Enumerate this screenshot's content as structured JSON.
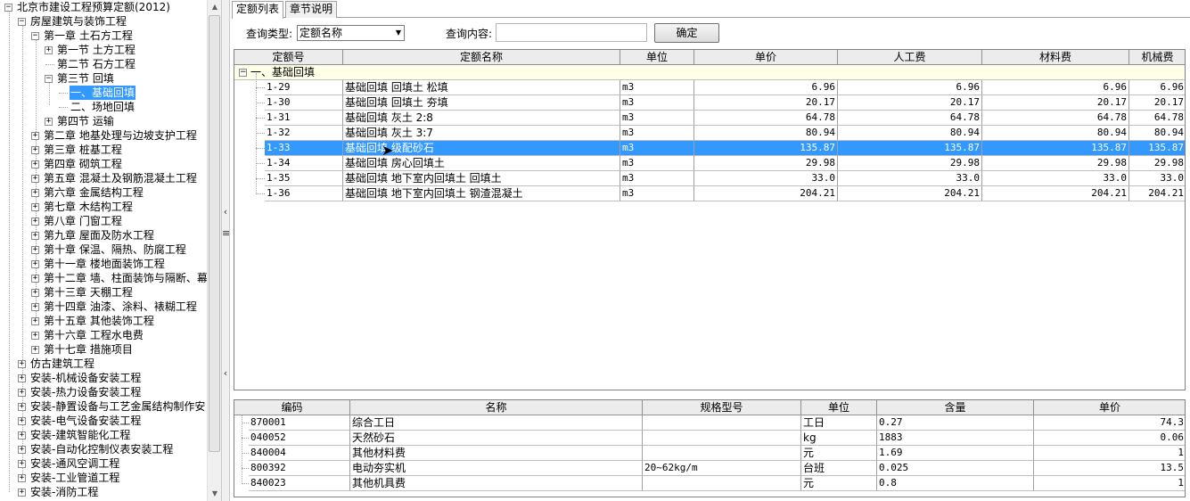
{
  "tree": {
    "items": [
      {
        "label": "北京市建设工程预算定额(2012)",
        "toggle": "−"
      },
      {
        "label": "房屋建筑与装饰工程",
        "toggle": "−"
      },
      {
        "label": "第一章 土石方工程",
        "toggle": "−"
      },
      {
        "label": "第一节 土方工程",
        "toggle": "+"
      },
      {
        "label": "第二节 石方工程",
        "toggle": ""
      },
      {
        "label": "第三节 回填",
        "toggle": "−"
      },
      {
        "label": "一、基础回填",
        "toggle": ""
      },
      {
        "label": "二、场地回填",
        "toggle": ""
      },
      {
        "label": "第四节 运输",
        "toggle": "+"
      },
      {
        "label": "第二章 地基处理与边坡支护工程",
        "toggle": "+"
      },
      {
        "label": "第三章 桩基工程",
        "toggle": "+"
      },
      {
        "label": "第四章 砌筑工程",
        "toggle": "+"
      },
      {
        "label": "第五章 混凝土及钢筋混凝土工程",
        "toggle": "+"
      },
      {
        "label": "第六章 金属结构工程",
        "toggle": "+"
      },
      {
        "label": "第七章 木结构工程",
        "toggle": "+"
      },
      {
        "label": "第八章 门窗工程",
        "toggle": "+"
      },
      {
        "label": "第九章 屋面及防水工程",
        "toggle": "+"
      },
      {
        "label": "第十章 保温、隔热、防腐工程",
        "toggle": "+"
      },
      {
        "label": "第十一章 楼地面装饰工程",
        "toggle": "+"
      },
      {
        "label": "第十二章 墙、柱面装饰与隔断、幕",
        "toggle": "+"
      },
      {
        "label": "第十三章 天棚工程",
        "toggle": "+"
      },
      {
        "label": "第十四章 油漆、涂料、裱糊工程",
        "toggle": "+"
      },
      {
        "label": "第十五章 其他装饰工程",
        "toggle": "+"
      },
      {
        "label": "第十六章 工程水电费",
        "toggle": "+"
      },
      {
        "label": "第十七章 措施项目",
        "toggle": "+"
      },
      {
        "label": "仿古建筑工程",
        "toggle": "+"
      },
      {
        "label": "安装-机械设备安装工程",
        "toggle": "+"
      },
      {
        "label": "安装-热力设备安装工程",
        "toggle": "+"
      },
      {
        "label": "安装-静置设备与工艺金属结构制作安",
        "toggle": "+"
      },
      {
        "label": "安装-电气设备安装工程",
        "toggle": "+"
      },
      {
        "label": "安装-建筑智能化工程",
        "toggle": "+"
      },
      {
        "label": "安装-自动化控制仪表安装工程",
        "toggle": "+"
      },
      {
        "label": "安装-通风空调工程",
        "toggle": "+"
      },
      {
        "label": "安装-工业管道工程",
        "toggle": "+"
      },
      {
        "label": "安装-消防工程",
        "toggle": "+"
      }
    ]
  },
  "tabs": [
    {
      "label": "定额列表"
    },
    {
      "label": "章节说明"
    }
  ],
  "query": {
    "type_label": "查询类型:",
    "type_value": "定额名称",
    "content_label": "查询内容:",
    "content_value": "",
    "button": "确定"
  },
  "grid1": {
    "columns": [
      "定额号",
      "定额名称",
      "单位",
      "单价",
      "人工费",
      "材料费",
      "机械费"
    ],
    "group": "一、基础回填",
    "group_toggle": "−",
    "rows": [
      {
        "code": "1-29",
        "name": "基础回填 回填土 松填",
        "unit": "m3",
        "price": "6.96",
        "labor": "6.96",
        "material": "6.96",
        "machine": "6.96"
      },
      {
        "code": "1-30",
        "name": "基础回填 回填土 夯填",
        "unit": "m3",
        "price": "20.17",
        "labor": "20.17",
        "material": "20.17",
        "machine": "20.17"
      },
      {
        "code": "1-31",
        "name": "基础回填 灰土 2:8",
        "unit": "m3",
        "price": "64.78",
        "labor": "64.78",
        "material": "64.78",
        "machine": "64.78"
      },
      {
        "code": "1-32",
        "name": "基础回填 灰土 3:7",
        "unit": "m3",
        "price": "80.94",
        "labor": "80.94",
        "material": "80.94",
        "machine": "80.94"
      },
      {
        "code": "1-33",
        "name": "基础回填 级配砂石",
        "unit": "m3",
        "price": "135.87",
        "labor": "135.87",
        "material": "135.87",
        "machine": "135.87"
      },
      {
        "code": "1-34",
        "name": "基础回填 房心回填土",
        "unit": "m3",
        "price": "29.98",
        "labor": "29.98",
        "material": "29.98",
        "machine": "29.98"
      },
      {
        "code": "1-35",
        "name": "基础回填 地下室内回填土 回填土",
        "unit": "m3",
        "price": "33.0",
        "labor": "33.0",
        "material": "33.0",
        "machine": "33.0"
      },
      {
        "code": "1-36",
        "name": "基础回填 地下室内回填土 钢渣混凝土",
        "unit": "m3",
        "price": "204.21",
        "labor": "204.21",
        "material": "204.21",
        "machine": "204.21"
      }
    ]
  },
  "grid2": {
    "columns": [
      "编码",
      "名称",
      "规格型号",
      "单位",
      "含量",
      "单价"
    ],
    "rows": [
      {
        "code": "870001",
        "name": "综合工日",
        "spec": "",
        "unit": "工日",
        "qty": "0.27",
        "price": "74.3"
      },
      {
        "code": "040052",
        "name": "天然砂石",
        "spec": "",
        "unit": "kg",
        "qty": "1883",
        "price": "0.06"
      },
      {
        "code": "840004",
        "name": "其他材料费",
        "spec": "",
        "unit": "元",
        "qty": "1.69",
        "price": "1"
      },
      {
        "code": "800392",
        "name": "电动夯实机",
        "spec": "20~62kg/m",
        "unit": "台班",
        "qty": "0.025",
        "price": "13.5"
      },
      {
        "code": "840023",
        "name": "其他机具费",
        "spec": "",
        "unit": "元",
        "qty": "0.8",
        "price": "1"
      }
    ]
  },
  "colors": {
    "selection": "#3399ff",
    "group_bg": "#ffffe8",
    "header_bg": "#ececec"
  }
}
